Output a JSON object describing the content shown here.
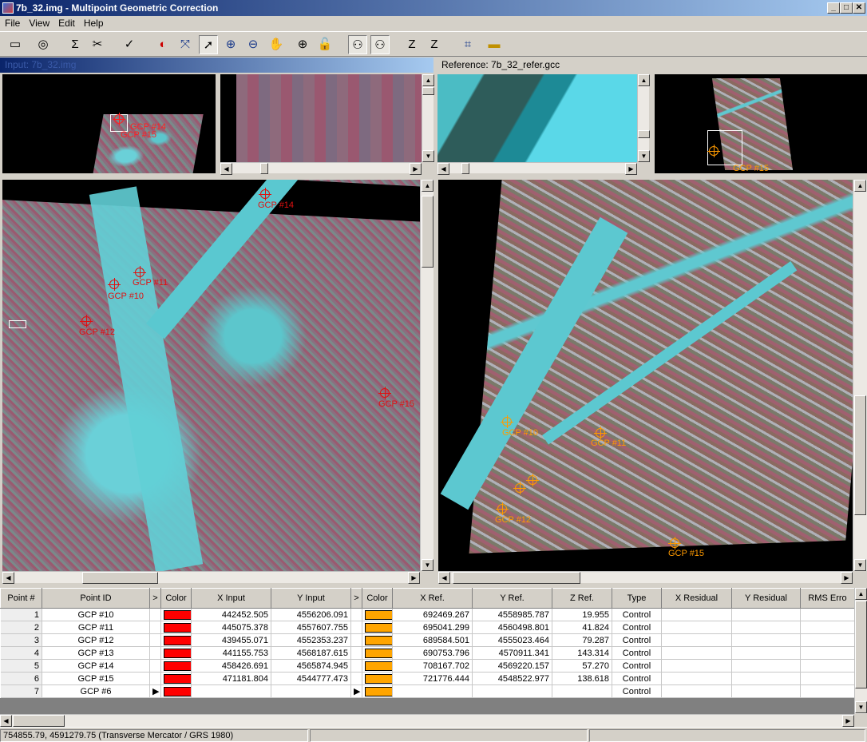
{
  "window": {
    "title": "7b_32.img - Multipoint Geometric Correction"
  },
  "menu": [
    "File",
    "View",
    "Edit",
    "Help"
  ],
  "toolbar_icons": [
    "display-icon",
    "load-icon",
    "sigma-icon",
    "tools-icon",
    "check-icon",
    "color-icon",
    "fit-icon",
    "select-arrow-icon",
    "zoom-in-icon",
    "zoom-out-icon",
    "pan-hand-icon",
    "crosshair-icon",
    "lock-icon",
    "binoculars-icon",
    "binoculars-down-icon",
    "z-icon",
    "z-refresh-icon",
    "grid-icon",
    "ruler-icon"
  ],
  "panes": {
    "input_header": "Input: 7b_32.img",
    "reference_header": "Reference: 7b_32_refer.gcc"
  },
  "gcp_labels": {
    "input_overview": [
      "GCP #14",
      "GCP #15"
    ],
    "input_main": [
      "GCP #14",
      "GCP #11",
      "GCP #10",
      "GCP #12",
      "GCP #15"
    ],
    "reference_overview": [
      "GCP #15"
    ],
    "reference_main": [
      "GCP #10",
      "GCP #11",
      "GCP #12",
      "GCP #15"
    ]
  },
  "table": {
    "headers": [
      "Point #",
      "Point ID",
      ">",
      "Color",
      "X Input",
      "Y Input",
      ">",
      "Color",
      "X Ref.",
      "Y Ref.",
      "Z Ref.",
      "Type",
      "X Residual",
      "Y Residual",
      "RMS Erro"
    ],
    "rows": [
      {
        "n": "1",
        "id": "GCP #10",
        "xin": "442452.505",
        "yin": "4556206.091",
        "xref": "692469.267",
        "yref": "4558985.787",
        "zref": "19.955",
        "type": "Control"
      },
      {
        "n": "2",
        "id": "GCP #11",
        "xin": "445075.378",
        "yin": "4557607.755",
        "xref": "695041.299",
        "yref": "4560498.801",
        "zref": "41.824",
        "type": "Control"
      },
      {
        "n": "3",
        "id": "GCP #12",
        "xin": "439455.071",
        "yin": "4552353.237",
        "xref": "689584.501",
        "yref": "4555023.464",
        "zref": "79.287",
        "type": "Control"
      },
      {
        "n": "4",
        "id": "GCP #13",
        "xin": "441155.753",
        "yin": "4568187.615",
        "xref": "690753.796",
        "yref": "4570911.341",
        "zref": "143.314",
        "type": "Control"
      },
      {
        "n": "5",
        "id": "GCP #14",
        "xin": "458426.691",
        "yin": "4565874.945",
        "xref": "708167.702",
        "yref": "4569220.157",
        "zref": "57.270",
        "type": "Control"
      },
      {
        "n": "6",
        "id": "GCP #15",
        "xin": "471181.804",
        "yin": "4544777.473",
        "xref": "721776.444",
        "yref": "4548522.977",
        "zref": "138.618",
        "type": "Control"
      },
      {
        "n": "7",
        "id": "GCP #6",
        "xin": "",
        "yin": "",
        "xref": "",
        "yref": "",
        "zref": "",
        "type": "Control"
      }
    ]
  },
  "colors": {
    "input_gcp": "#ff0000",
    "ref_gcp": "#ffa500",
    "title_bar": "#0a246a"
  },
  "status": {
    "coords": "754855.79, 4591279.75  (Transverse Mercator / GRS 1980)"
  }
}
